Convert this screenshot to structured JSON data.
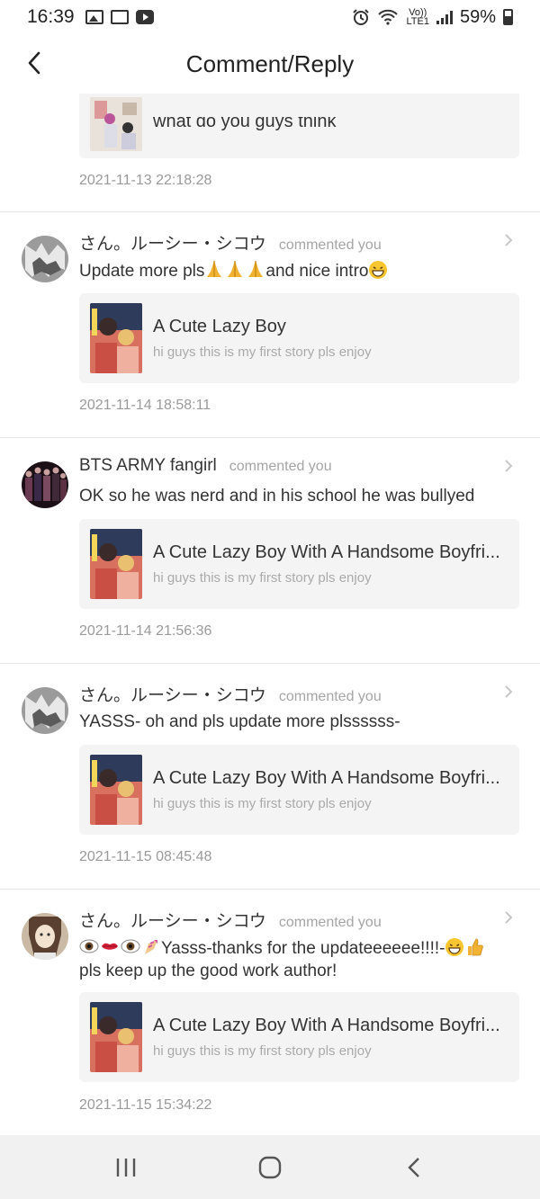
{
  "status_bar": {
    "time": "16:39",
    "network": "LTE1",
    "volte": "Vo))",
    "battery": "59%"
  },
  "header": {
    "title": "Comment/Reply"
  },
  "top_partial": {
    "card_title": "what do you guys think",
    "timestamp": "2021-11-13 22:18:28"
  },
  "items": [
    {
      "user": "さん。ルーシー・シコウ",
      "action": "commented you",
      "comment_before": "Update more pls",
      "comment_after": "and nice intro",
      "card_title": "A Cute Lazy Boy",
      "card_sub": "hi guys this is my first story pls enjoy",
      "timestamp": "2021-11-14 18:58:11"
    },
    {
      "user": "BTS ARMY fangirl",
      "action": "commented you",
      "comment": "OK so he was nerd and in his school he was bullyed",
      "card_title": "A Cute Lazy Boy With A Handsome Boyfri...",
      "card_sub": "hi guys this is my first story pls enjoy",
      "timestamp": "2021-11-14 21:56:36"
    },
    {
      "user": "さん。ルーシー・シコウ",
      "action": "commented you",
      "comment": "YASSS- oh and pls update more plssssss-",
      "card_title": "A Cute Lazy Boy With A Handsome Boyfri...",
      "card_sub": "hi guys this is my first story pls enjoy",
      "timestamp": "2021-11-15 08:45:48"
    },
    {
      "user": "さん。ルーシー・シコウ",
      "action": "commented you",
      "comment_before": "Yasss-thanks for the updateeeeee!!!!-",
      "comment_after": "pls keep up the good work author!",
      "card_title": "A Cute Lazy Boy With A Handsome Boyfri...",
      "card_sub": "hi guys this is my first story pls enjoy",
      "timestamp": "2021-11-15 15:34:22"
    }
  ],
  "colors": {
    "card_bg": "#f4f4f4",
    "muted": "#9a9a9a",
    "divider": "#e6e6e6"
  }
}
